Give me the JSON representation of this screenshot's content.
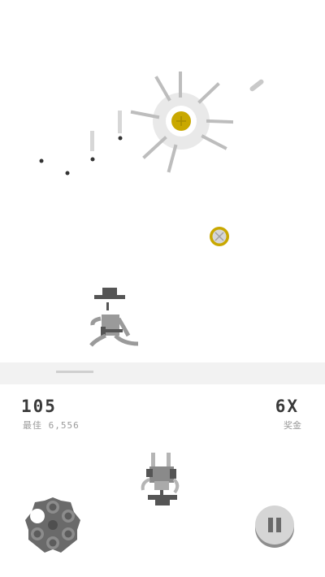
{
  "hud": {
    "score": "105",
    "best_label": "最佳 6,556",
    "multiplier": "6X",
    "bonus_label": "奖金"
  },
  "colors": {
    "background": "#ffffff",
    "ground_strip": "#f2f2f2",
    "character": "#8a8a8a",
    "character_dark": "#555555",
    "coin": "#c9a800",
    "coin_ring": "#e6e6e6",
    "dot": "#333333",
    "text_primary": "#3a3a3a",
    "text_secondary": "#9a9a9a",
    "button": "#6a6a6a"
  },
  "icons": {
    "revolver": "revolver-cylinder-icon",
    "pause": "pause-icon"
  }
}
